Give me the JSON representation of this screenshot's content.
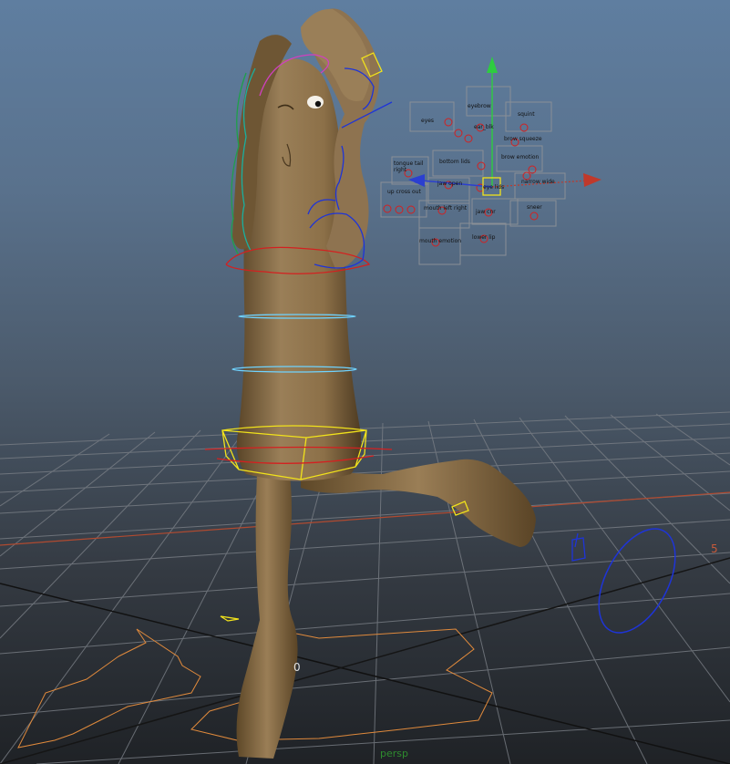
{
  "viewport": {
    "camera_label": "persp",
    "grid_labels": {
      "origin": "0",
      "far": "5"
    }
  },
  "face_ui": {
    "labels": [
      "eyes",
      "eyebrow",
      "squint",
      "ear_blk",
      "brow squeeze",
      "tongue tail right",
      "bottom lids",
      "brow emotion",
      "jaw open",
      "eye lids",
      "narrow wide",
      "up cross out",
      "mouth left right",
      "jaw cnr",
      "sneer",
      "mouth emotion",
      "lower lip"
    ]
  },
  "colors": {
    "body": "#8a6f48",
    "grid": "#7a7f86",
    "axis_x": "#c0392b",
    "axis_y": "#2ecc40",
    "axis_z": "#2b3fd0",
    "ctrl_yellow": "#f1e21b",
    "ctrl_cyan": "#6fd3ff",
    "ctrl_red": "#d42020",
    "ctrl_blue": "#1e34d8",
    "ctrl_orange": "#e88a3c"
  }
}
